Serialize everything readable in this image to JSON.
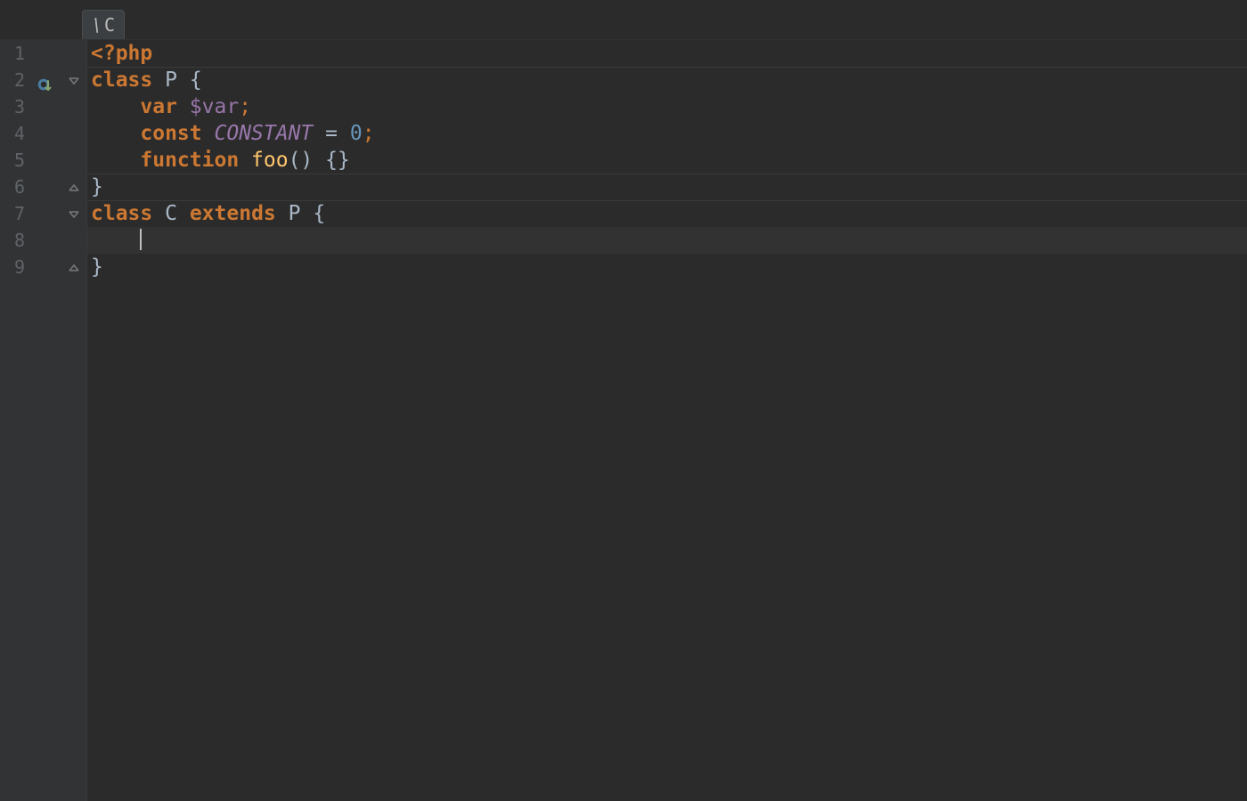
{
  "breadcrumb": {
    "label": "C",
    "backslash": "\\",
    "icon": "class-icon"
  },
  "gutter": {
    "line_numbers": [
      "1",
      "2",
      "3",
      "4",
      "5",
      "6",
      "7",
      "8",
      "9"
    ],
    "icons": {
      "2": "override-down-icon"
    },
    "fold": {
      "2": "open-down",
      "6": "close-up",
      "7": "open-down",
      "9": "close-up"
    }
  },
  "code": {
    "1": {
      "tokens": [
        {
          "cls": "tok-tag",
          "t": "<?php"
        }
      ]
    },
    "2": {
      "tokens": [
        {
          "cls": "tok-kw",
          "t": "class"
        },
        {
          "cls": "",
          "t": " "
        },
        {
          "cls": "tok-class",
          "t": "P"
        },
        {
          "cls": "",
          "t": " "
        },
        {
          "cls": "tok-brace",
          "t": "{"
        }
      ]
    },
    "3": {
      "indent": "    ",
      "tokens": [
        {
          "cls": "tok-kw",
          "t": "var"
        },
        {
          "cls": "",
          "t": " "
        },
        {
          "cls": "tok-var",
          "t": "$var"
        },
        {
          "cls": "tok-punc",
          "t": ";"
        }
      ]
    },
    "4": {
      "indent": "    ",
      "tokens": [
        {
          "cls": "tok-kw",
          "t": "const"
        },
        {
          "cls": "",
          "t": " "
        },
        {
          "cls": "tok-const",
          "t": "CONSTANT"
        },
        {
          "cls": "",
          "t": " "
        },
        {
          "cls": "tok-op",
          "t": "="
        },
        {
          "cls": "",
          "t": " "
        },
        {
          "cls": "tok-num",
          "t": "0"
        },
        {
          "cls": "tok-punc",
          "t": ";"
        }
      ]
    },
    "5": {
      "indent": "    ",
      "tokens": [
        {
          "cls": "tok-kw",
          "t": "function"
        },
        {
          "cls": "",
          "t": " "
        },
        {
          "cls": "tok-func",
          "t": "foo"
        },
        {
          "cls": "tok-brace",
          "t": "()"
        },
        {
          "cls": "",
          "t": " "
        },
        {
          "cls": "tok-brace",
          "t": "{}"
        }
      ]
    },
    "6": {
      "tokens": [
        {
          "cls": "tok-brace",
          "t": "}"
        }
      ]
    },
    "7": {
      "tokens": [
        {
          "cls": "tok-kw",
          "t": "class"
        },
        {
          "cls": "",
          "t": " "
        },
        {
          "cls": "tok-class",
          "t": "C"
        },
        {
          "cls": "",
          "t": " "
        },
        {
          "cls": "tok-kw",
          "t": "extends"
        },
        {
          "cls": "",
          "t": " "
        },
        {
          "cls": "tok-class",
          "t": "P"
        },
        {
          "cls": "",
          "t": " "
        },
        {
          "cls": "tok-brace",
          "t": "{"
        }
      ]
    },
    "8": {
      "indent": "    ",
      "current": true,
      "caret": true,
      "tokens": []
    },
    "9": {
      "tokens": [
        {
          "cls": "tok-brace",
          "t": "}"
        }
      ]
    }
  },
  "colors": {
    "background": "#2b2b2b",
    "gutter_bg": "#313335",
    "line_number": "#606366",
    "keyword": "#cc7832",
    "identifier": "#a9b7c6",
    "variable": "#9876aa",
    "function": "#ffc66d",
    "number": "#6897bb",
    "current_line": "#323232"
  }
}
